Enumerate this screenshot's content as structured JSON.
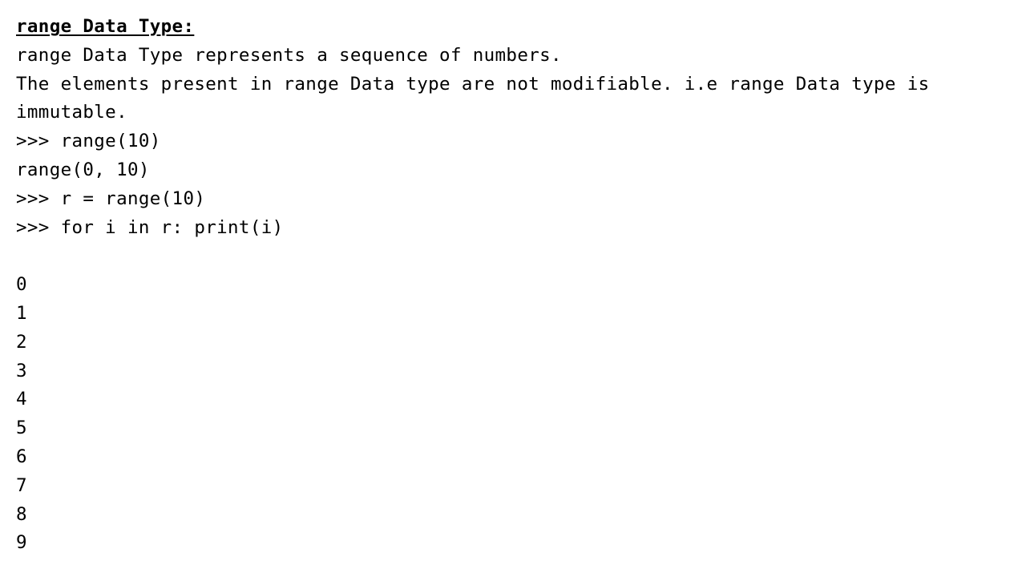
{
  "heading": "range Data Type:",
  "description": [
    "range Data Type represents a sequence of numbers.",
    "The elements present in range Data type are not modifiable. i.e range Data type is immutable."
  ],
  "code_lines": [
    ">>> range(10)",
    "range(0, 10)",
    ">>> r = range(10)",
    ">>> for i in r: print(i)"
  ],
  "output_lines": [
    "0",
    "1",
    "2",
    "3",
    "4",
    "5",
    "6",
    "7",
    "8",
    "9"
  ]
}
